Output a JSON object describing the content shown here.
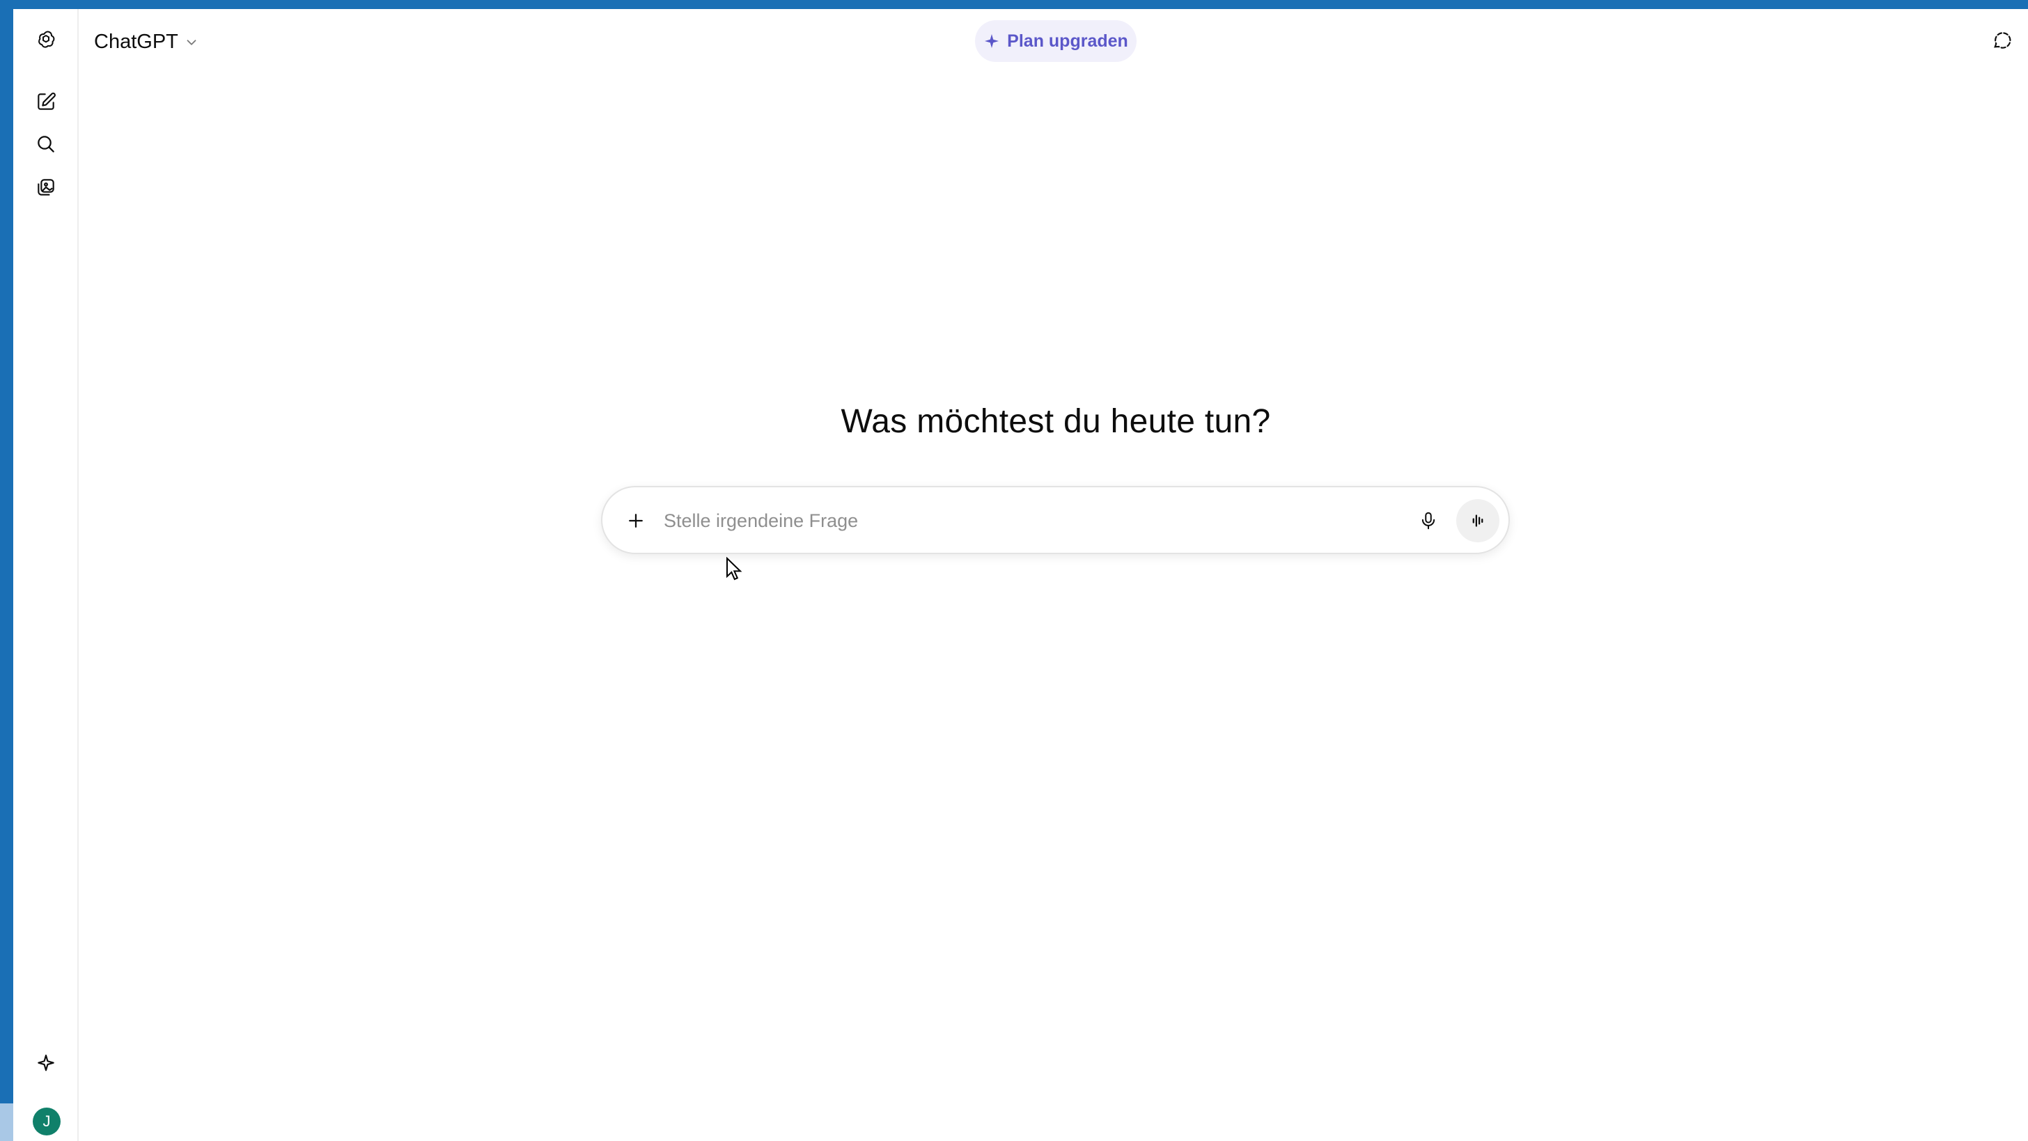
{
  "header": {
    "model_name": "ChatGPT",
    "upgrade_label": "Plan upgraden"
  },
  "main": {
    "headline": "Was möchtest du heute tun?"
  },
  "composer": {
    "placeholder": "Stelle irgendeine Frage",
    "value": ""
  },
  "user": {
    "initial": "J",
    "avatar_color": "#10806a"
  },
  "colors": {
    "accent": "#5b57c9",
    "upgrade_bg": "#f1f0fb",
    "window_frame": "#1a6fb5"
  },
  "icons": {
    "sidebar": [
      "openai-logo-icon",
      "new-chat-icon",
      "search-icon",
      "library-icon",
      "sparkle-icon"
    ],
    "composer": [
      "plus-icon",
      "microphone-icon",
      "voice-mode-icon"
    ],
    "header": [
      "chevron-down-icon",
      "sparkle-icon",
      "temporary-chat-icon"
    ]
  }
}
